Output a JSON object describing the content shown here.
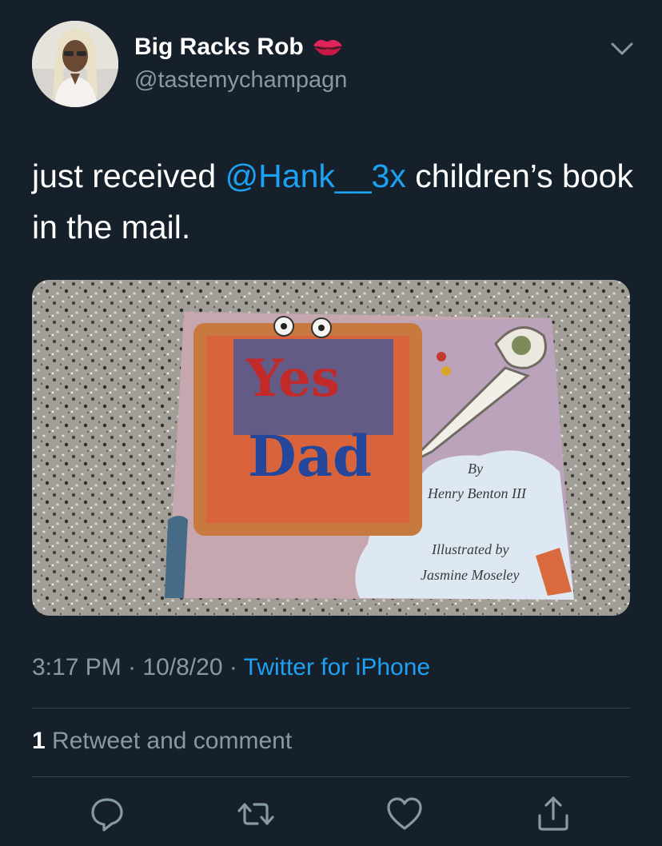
{
  "user": {
    "display_name": "Big Racks Rob",
    "badge_icon": "kiss-lips-icon",
    "handle": "@tastemychampagn"
  },
  "tweet": {
    "text_before": "just received ",
    "mention": "@Hank__3x",
    "text_after": " children’s book in the mail."
  },
  "media": {
    "book_title_line1": "Yes",
    "book_title_line2": "Dad",
    "book_by": "By",
    "book_author": "Henry Benton III",
    "book_illustrated_by": "Illustrated by",
    "book_illustrator": "Jasmine Moseley"
  },
  "meta": {
    "time": "3:17 PM",
    "separator": " · ",
    "date": "10/8/20",
    "source": "Twitter for iPhone"
  },
  "stats": {
    "count": "1",
    "label": " Retweet and comment"
  },
  "actions": [
    "reply-icon",
    "retweet-icon",
    "like-icon",
    "share-icon"
  ],
  "colors": {
    "background": "#15202b",
    "accent": "#1da1f2",
    "muted": "#8899a6",
    "divider": "#38444d"
  }
}
